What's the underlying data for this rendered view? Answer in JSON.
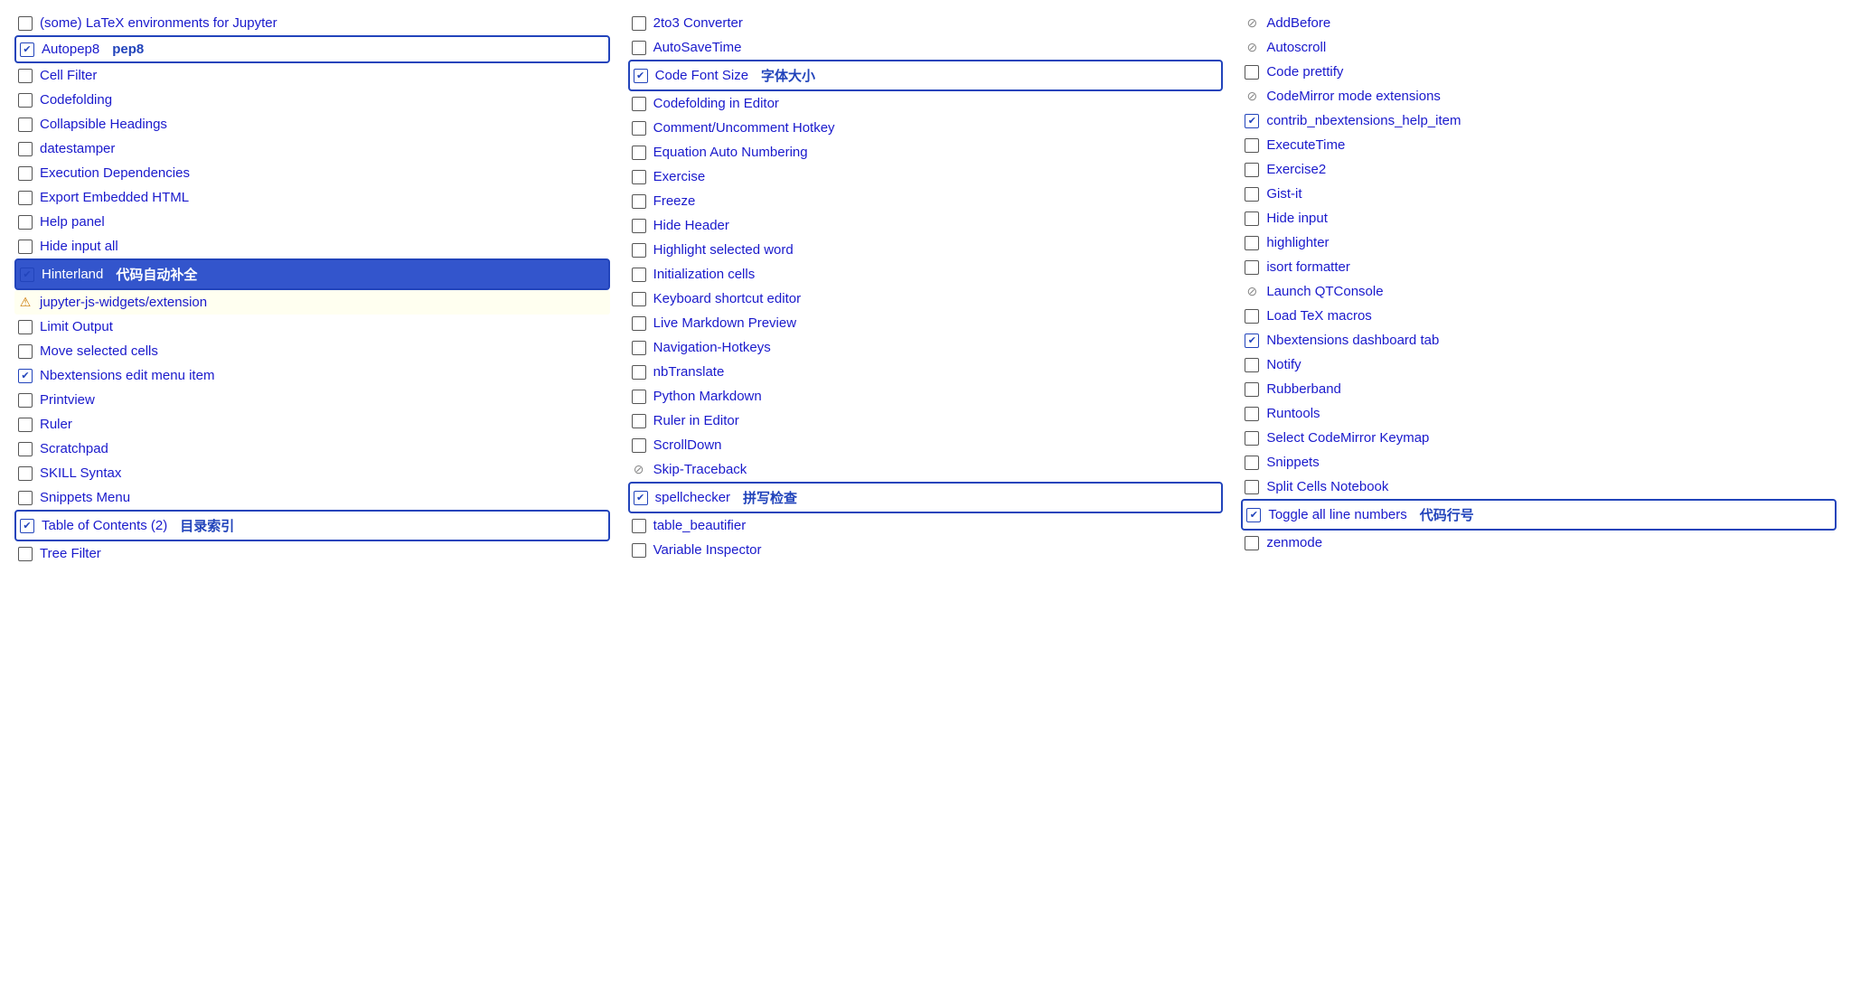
{
  "columns": [
    {
      "id": "col1",
      "items": [
        {
          "id": "latex",
          "type": "unchecked",
          "label": "(some) LaTeX environments for Jupyter",
          "badge": null,
          "style": ""
        },
        {
          "id": "autopep8",
          "type": "checked",
          "label": "Autopep8",
          "badge": "pep8",
          "style": "boxed"
        },
        {
          "id": "cellfilter",
          "type": "unchecked",
          "label": "Cell Filter",
          "badge": null,
          "style": ""
        },
        {
          "id": "codefolding",
          "type": "unchecked",
          "label": "Codefolding",
          "badge": null,
          "style": ""
        },
        {
          "id": "collapsibleheadings",
          "type": "unchecked",
          "label": "Collapsible Headings",
          "badge": null,
          "style": ""
        },
        {
          "id": "datestamper",
          "type": "unchecked",
          "label": "datestamper",
          "badge": null,
          "style": ""
        },
        {
          "id": "executiondeps",
          "type": "unchecked",
          "label": "Execution Dependencies",
          "badge": null,
          "style": ""
        },
        {
          "id": "exportembeddedhtml",
          "type": "unchecked",
          "label": "Export Embedded HTML",
          "badge": null,
          "style": ""
        },
        {
          "id": "helppanel",
          "type": "unchecked",
          "label": "Help panel",
          "badge": null,
          "style": ""
        },
        {
          "id": "hideinputall",
          "type": "unchecked",
          "label": "Hide input all",
          "badge": null,
          "style": ""
        },
        {
          "id": "hinterland",
          "type": "checked",
          "label": "Hinterland",
          "badge": "代码自动补全",
          "style": "highlighted"
        },
        {
          "id": "jupyterjswidgets",
          "type": "warning",
          "label": "jupyter-js-widgets/extension",
          "badge": null,
          "style": "warning-bg"
        },
        {
          "id": "limitoutput",
          "type": "unchecked",
          "label": "Limit Output",
          "badge": null,
          "style": ""
        },
        {
          "id": "moveselectedcells",
          "type": "unchecked",
          "label": "Move selected cells",
          "badge": null,
          "style": ""
        },
        {
          "id": "nbextensionsedit",
          "type": "checked",
          "label": "Nbextensions edit menu item",
          "badge": null,
          "style": ""
        },
        {
          "id": "printview",
          "type": "unchecked",
          "label": "Printview",
          "badge": null,
          "style": ""
        },
        {
          "id": "ruler",
          "type": "unchecked",
          "label": "Ruler",
          "badge": null,
          "style": ""
        },
        {
          "id": "scratchpad",
          "type": "unchecked",
          "label": "Scratchpad",
          "badge": null,
          "style": ""
        },
        {
          "id": "skillsyntax",
          "type": "unchecked",
          "label": "SKILL Syntax",
          "badge": null,
          "style": ""
        },
        {
          "id": "snippetsmenu",
          "type": "unchecked",
          "label": "Snippets Menu",
          "badge": null,
          "style": ""
        },
        {
          "id": "toc2",
          "type": "checked",
          "label": "Table of Contents (2)",
          "badge": "目录索引",
          "style": "boxed"
        },
        {
          "id": "treefilter",
          "type": "unchecked",
          "label": "Tree Filter",
          "badge": null,
          "style": ""
        }
      ]
    },
    {
      "id": "col2",
      "items": [
        {
          "id": "2to3",
          "type": "unchecked",
          "label": "2to3 Converter",
          "badge": null,
          "style": ""
        },
        {
          "id": "autosavetime",
          "type": "unchecked",
          "label": "AutoSaveTime",
          "badge": null,
          "style": ""
        },
        {
          "id": "codefontsize",
          "type": "checked",
          "label": "Code Font Size",
          "badge": "字体大小",
          "style": "boxed"
        },
        {
          "id": "codefoldingeditor",
          "type": "unchecked",
          "label": "Codefolding in Editor",
          "badge": null,
          "style": ""
        },
        {
          "id": "commentuncomment",
          "type": "unchecked",
          "label": "Comment/Uncomment Hotkey",
          "badge": null,
          "style": ""
        },
        {
          "id": "equationauto",
          "type": "unchecked",
          "label": "Equation Auto Numbering",
          "badge": null,
          "style": ""
        },
        {
          "id": "exercise",
          "type": "unchecked",
          "label": "Exercise",
          "badge": null,
          "style": ""
        },
        {
          "id": "freeze",
          "type": "unchecked",
          "label": "Freeze",
          "badge": null,
          "style": ""
        },
        {
          "id": "hideheader",
          "type": "unchecked",
          "label": "Hide Header",
          "badge": null,
          "style": ""
        },
        {
          "id": "highlightselected",
          "type": "unchecked",
          "label": "Highlight selected word",
          "badge": null,
          "style": ""
        },
        {
          "id": "initcells",
          "type": "unchecked",
          "label": "Initialization cells",
          "badge": null,
          "style": ""
        },
        {
          "id": "keyboardshortcut",
          "type": "unchecked",
          "label": "Keyboard shortcut editor",
          "badge": null,
          "style": ""
        },
        {
          "id": "livemarkdown",
          "type": "unchecked",
          "label": "Live Markdown Preview",
          "badge": null,
          "style": ""
        },
        {
          "id": "navigationhotkeys",
          "type": "unchecked",
          "label": "Navigation-Hotkeys",
          "badge": null,
          "style": ""
        },
        {
          "id": "nbtranslate",
          "type": "unchecked",
          "label": "nbTranslate",
          "badge": null,
          "style": ""
        },
        {
          "id": "pythonmarkdown",
          "type": "unchecked",
          "label": "Python Markdown",
          "badge": null,
          "style": ""
        },
        {
          "id": "rulereditor",
          "type": "unchecked",
          "label": "Ruler in Editor",
          "badge": null,
          "style": ""
        },
        {
          "id": "scrolldown",
          "type": "unchecked",
          "label": "ScrollDown",
          "badge": null,
          "style": ""
        },
        {
          "id": "skiptraceback",
          "type": "disabled",
          "label": "Skip-Traceback",
          "badge": null,
          "style": ""
        },
        {
          "id": "spellchecker",
          "type": "checked",
          "label": "spellchecker",
          "badge": "拼写检查",
          "style": "boxed"
        },
        {
          "id": "tablebeautifier",
          "type": "unchecked",
          "label": "table_beautifier",
          "badge": null,
          "style": ""
        },
        {
          "id": "variableinspector",
          "type": "unchecked",
          "label": "Variable Inspector",
          "badge": null,
          "style": ""
        }
      ]
    },
    {
      "id": "col3",
      "items": [
        {
          "id": "addbefore",
          "type": "disabled",
          "label": "AddBefore",
          "badge": null,
          "style": ""
        },
        {
          "id": "autoscroll",
          "type": "disabled",
          "label": "Autoscroll",
          "badge": null,
          "style": ""
        },
        {
          "id": "codeprettify",
          "type": "unchecked",
          "label": "Code prettify",
          "badge": null,
          "style": ""
        },
        {
          "id": "codemirrormode",
          "type": "disabled",
          "label": "CodeMirror mode extensions",
          "badge": null,
          "style": ""
        },
        {
          "id": "contribnbext",
          "type": "checked",
          "label": "contrib_nbextensions_help_item",
          "badge": null,
          "style": ""
        },
        {
          "id": "executetime",
          "type": "unchecked",
          "label": "ExecuteTime",
          "badge": null,
          "style": ""
        },
        {
          "id": "exercise2",
          "type": "unchecked",
          "label": "Exercise2",
          "badge": null,
          "style": ""
        },
        {
          "id": "gistit",
          "type": "unchecked",
          "label": "Gist-it",
          "badge": null,
          "style": ""
        },
        {
          "id": "hideinput",
          "type": "unchecked",
          "label": "Hide input",
          "badge": null,
          "style": ""
        },
        {
          "id": "highlighter",
          "type": "unchecked",
          "label": "highlighter",
          "badge": null,
          "style": ""
        },
        {
          "id": "isortformatter",
          "type": "unchecked",
          "label": "isort formatter",
          "badge": null,
          "style": ""
        },
        {
          "id": "launchqtconsole",
          "type": "disabled",
          "label": "Launch QTConsole",
          "badge": null,
          "style": ""
        },
        {
          "id": "loadtexmacros",
          "type": "unchecked",
          "label": "Load TeX macros",
          "badge": null,
          "style": ""
        },
        {
          "id": "nbextdash",
          "type": "checked",
          "label": "Nbextensions dashboard tab",
          "badge": null,
          "style": ""
        },
        {
          "id": "notify",
          "type": "unchecked",
          "label": "Notify",
          "badge": null,
          "style": ""
        },
        {
          "id": "rubberband",
          "type": "unchecked",
          "label": "Rubberband",
          "badge": null,
          "style": ""
        },
        {
          "id": "runtools",
          "type": "unchecked",
          "label": "Runtools",
          "badge": null,
          "style": ""
        },
        {
          "id": "selectcodemirror",
          "type": "unchecked",
          "label": "Select CodeMirror Keymap",
          "badge": null,
          "style": ""
        },
        {
          "id": "snippets",
          "type": "unchecked",
          "label": "Snippets",
          "badge": null,
          "style": ""
        },
        {
          "id": "splitcells",
          "type": "unchecked",
          "label": "Split Cells Notebook",
          "badge": null,
          "style": ""
        },
        {
          "id": "togglelinenumbers",
          "type": "checked",
          "label": "Toggle all line numbers",
          "badge": "代码行号",
          "style": "boxed"
        },
        {
          "id": "zenmode",
          "type": "unchecked",
          "label": "zenmode",
          "badge": null,
          "style": ""
        }
      ]
    }
  ]
}
